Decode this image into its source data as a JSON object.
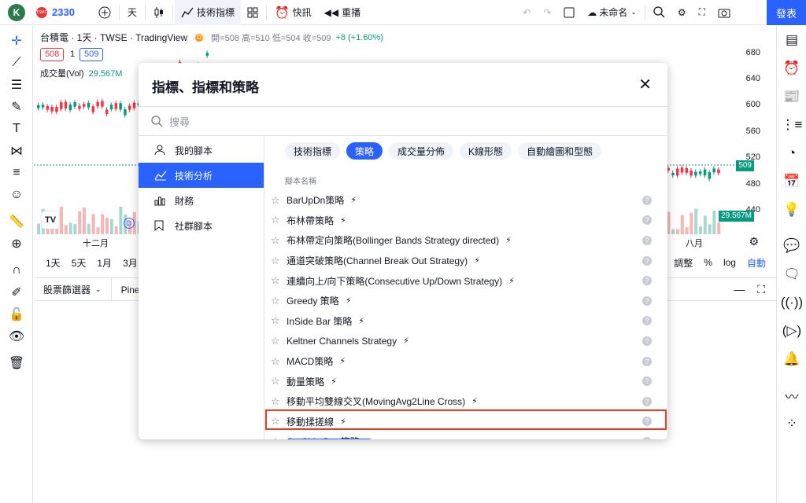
{
  "topbar": {
    "avatar_letter": "K",
    "symbol": "2330",
    "interval": "天",
    "indicators_label": "技術指標",
    "alert_label": "快訊",
    "replay_label": "重播",
    "layout_name": "未命名",
    "publish_label": "發表"
  },
  "chart": {
    "title": "台積電 · 1天 · TWSE · TradingView",
    "badge": "D",
    "ohlc": "開=508 高=510 低=504 收=509",
    "change": "+8 (+1.60%)",
    "bid": "508",
    "spread": "1",
    "ask": "509",
    "volume_label": "成交量(Vol)",
    "volume_value": "29.567M",
    "y_ticks": [
      "680",
      "640",
      "600",
      "560",
      "520",
      "480",
      "440"
    ],
    "price_tag": "509",
    "volume_tag": "29.567M",
    "x_labels": [
      "十二月",
      "八月"
    ],
    "timeframes": [
      "1天",
      "5天",
      "1月",
      "3月"
    ],
    "right_controls": [
      "調整",
      "%",
      "log",
      "自動"
    ],
    "accent_color": "#2962ff",
    "up_color": "#089981",
    "down_color": "#f23645"
  },
  "panel": {
    "screener_label": "股票篩選器",
    "pine_label": "Pine編"
  },
  "modal": {
    "title": "指標、指標和策略",
    "search_placeholder": "搜尋",
    "sidebar": [
      {
        "label": "我的腳本",
        "icon": "user-icon"
      },
      {
        "label": "技術分析",
        "icon": "chart-line-icon"
      },
      {
        "label": "財務",
        "icon": "bar-chart-icon"
      },
      {
        "label": "社群腳本",
        "icon": "bookmark-icon"
      }
    ],
    "chips": [
      "技術指標",
      "策略",
      "成交量分佈",
      "K線形態",
      "自動繪圖和型態"
    ],
    "column_header": "腳本名稱",
    "rows": [
      "BarUpDn策略",
      "布林帶策略",
      "布林帶定向策略(Bollinger Bands Strategy directed)",
      "通道突破策略(Channel Break Out Strategy)",
      "連續向上/向下策略(Consecutive Up/Down Strategy)",
      "Greedy 策略",
      "InSide Bar 策略",
      "Keltner Channels Strategy",
      "MACD策略",
      "動量策略",
      "移動平均雙線交叉(MovingAvg2Line Cross)",
      "移動揉搓線",
      "OutSide Bar 策略"
    ],
    "highlight_color": "#f23c1b"
  }
}
